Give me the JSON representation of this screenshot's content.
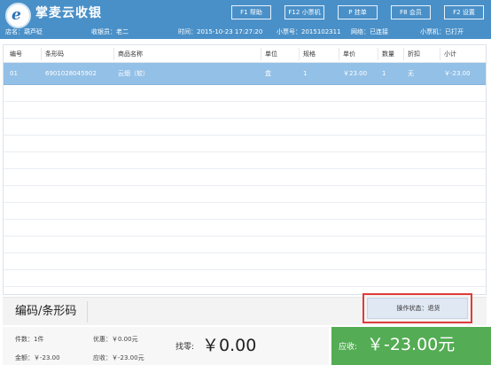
{
  "header": {
    "app_title": "掌麦云收银",
    "buttons": [
      {
        "label": "F1 帮助"
      },
      {
        "label": "F12 小票机"
      },
      {
        "label": "P 挂单"
      },
      {
        "label": "F8 会员"
      },
      {
        "label": "F2 设置"
      }
    ],
    "info": {
      "store": "店名：葫芦砭",
      "cashier": "收银员：老二",
      "time": "时间：2015-10-23 17:27:20",
      "ticket_no": "小票号：2015102311",
      "network": "网络：已连接",
      "printer": "小票机：已打开"
    }
  },
  "table": {
    "columns": [
      "编号",
      "条形码",
      "商品名称",
      "单位",
      "规格",
      "单价",
      "数量",
      "折扣",
      "小计"
    ],
    "rows": [
      {
        "id": "01",
        "barcode": "6901028045902",
        "name": "云烟（软）",
        "unit": "盒",
        "spec": "1",
        "price": "￥23.00",
        "qty": "1",
        "discount": "无",
        "subtotal": "￥-23.00"
      }
    ]
  },
  "barcode": {
    "label": "编码/条形码",
    "value": ""
  },
  "operation": {
    "status": "操作状态：退货"
  },
  "summary": {
    "count": "件数：1件",
    "discount": "优惠：￥0.00元",
    "amount": "金额：￥-23.00",
    "receivable": "应收：￥-23.00元",
    "change_label": "找零:",
    "change_value": "￥0.00",
    "due_label": "应收:",
    "due_value": "￥-23.00元"
  },
  "colors": {
    "header": "#4a90c8",
    "selected_row": "#93c0e6",
    "due_panel": "#54ac54",
    "highlight_border": "#e03b3b"
  }
}
